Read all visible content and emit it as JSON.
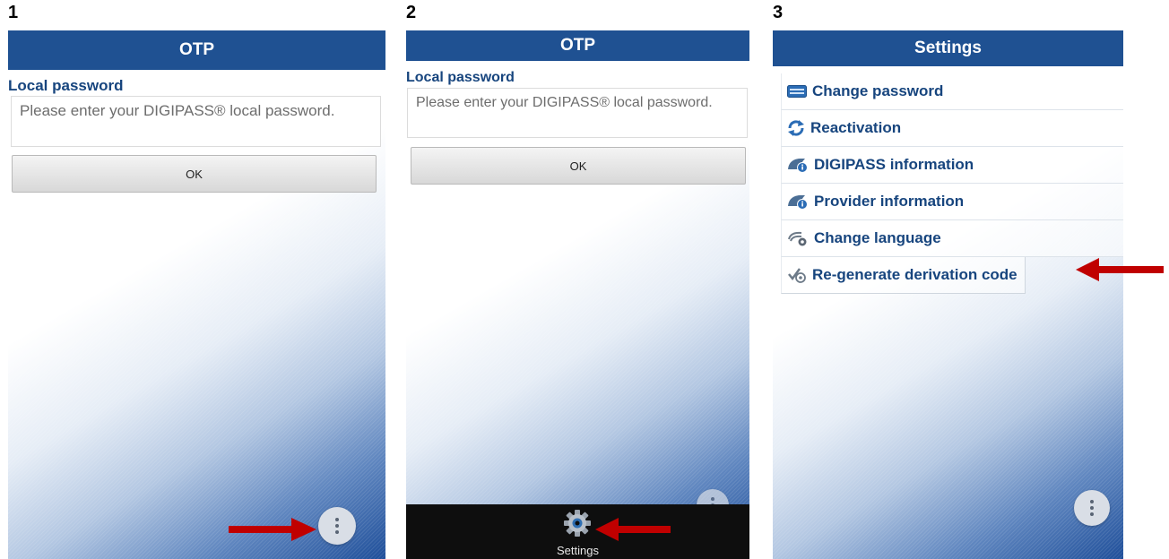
{
  "steps": [
    "1",
    "2",
    "3"
  ],
  "screen1": {
    "title": "OTP",
    "field_label": "Local password",
    "placeholder": "Please enter your DIGIPASS® local password.",
    "ok_label": "OK",
    "menu_icon": "more-vert-icon"
  },
  "screen2": {
    "title": "OTP",
    "field_label": "Local password",
    "placeholder": "Please enter your DIGIPASS® local password.",
    "ok_label": "OK",
    "bottom_settings_label": "Settings",
    "settings_icon": "gear-icon"
  },
  "screen3": {
    "title": "Settings",
    "items": [
      {
        "label": "Change password",
        "icon": "keyboard-icon"
      },
      {
        "label": "Reactivation",
        "icon": "refresh-icon"
      },
      {
        "label": "DIGIPASS information",
        "icon": "info-badge-icon"
      },
      {
        "label": "Provider information",
        "icon": "info-badge-icon"
      },
      {
        "label": "Change language",
        "icon": "language-icon"
      },
      {
        "label": "Re-generate derivation code",
        "icon": "regenerate-icon"
      }
    ]
  },
  "colors": {
    "header": "#1f5192",
    "label_text": "#17457e",
    "arrow": "#c00000",
    "bottom_bar": "#0e0e0e"
  }
}
